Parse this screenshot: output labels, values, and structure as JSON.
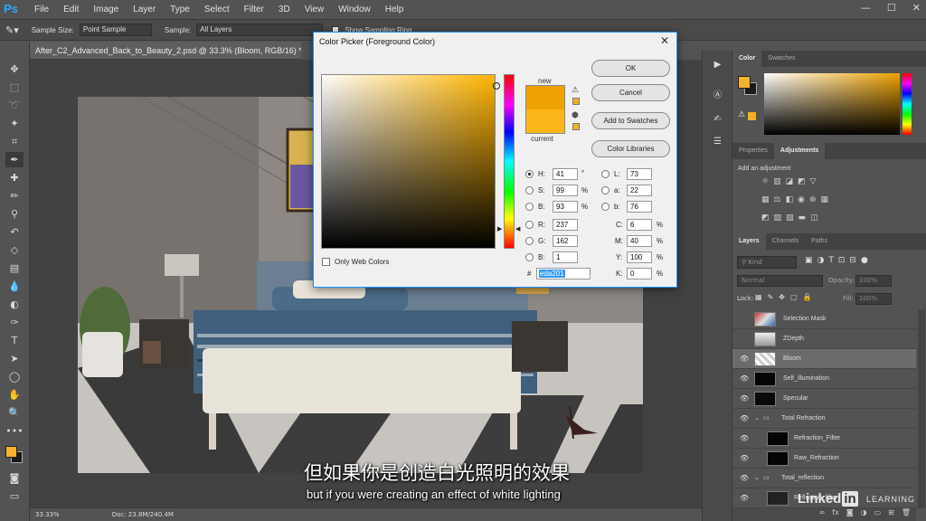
{
  "app": {
    "logo": "Ps"
  },
  "menu": [
    "File",
    "Edit",
    "Image",
    "Layer",
    "Type",
    "Select",
    "Filter",
    "3D",
    "View",
    "Window",
    "Help"
  ],
  "window_controls": [
    "—",
    "☐",
    "✕"
  ],
  "options_bar": {
    "sample_size_label": "Sample Size:",
    "sample_size_value": "Point Sample",
    "sample_label": "Sample:",
    "sample_value": "All Layers",
    "show_ring_label": "Show Sampling Ring"
  },
  "document": {
    "tab_title": "After_C2_Advanced_Back_to_Beauty_2.psd @ 33.3% (Bloom, RGB/16) *",
    "zoom": "33.33%",
    "doc_size": "Doc: 23.8M/240.4M"
  },
  "color_picker": {
    "title": "Color Picker (Foreground Color)",
    "new_label": "new",
    "current_label": "current",
    "buttons": {
      "ok": "OK",
      "cancel": "Cancel",
      "add_swatches": "Add to Swatches",
      "libraries": "Color Libraries"
    },
    "fields": {
      "H": "41",
      "S": "99",
      "Bv": "93",
      "R": "237",
      "G": "162",
      "Bc": "1",
      "L": "73",
      "a": "22",
      "b": "76",
      "C": "6",
      "M": "40",
      "Y": "100",
      "K": "0"
    },
    "units": {
      "deg": "°",
      "pct": "%"
    },
    "hex_label": "#",
    "hex": "eda201",
    "web_only_label": "Only Web Colors",
    "new_color": "#eda201",
    "current_color": "#fcb61a"
  },
  "panels": {
    "color_tabs": [
      "Color",
      "Swatches"
    ],
    "adj_tabs": [
      "Properties",
      "Adjustments"
    ],
    "add_adjustment": "Add an adjustment",
    "layers_tabs": [
      "Layers",
      "Channels",
      "Paths"
    ],
    "kind_label": "Kind",
    "blend_mode": "Normal",
    "opacity_label": "Opacity:",
    "opacity_value": "100%",
    "lock_label": "Lock:",
    "fill_label": "Fill:",
    "fill_value": "100%",
    "layers": [
      {
        "name": "Selection Mask",
        "visible": false
      },
      {
        "name": "ZDepth",
        "visible": false
      },
      {
        "name": "Bloom",
        "visible": true,
        "selected": true
      },
      {
        "name": "Self_illumination",
        "visible": true
      },
      {
        "name": "Specular",
        "visible": true
      },
      {
        "name": "Total Refraction",
        "visible": true,
        "group": true
      },
      {
        "name": "Refraction_Filter",
        "visible": true
      },
      {
        "name": "Raw_Refraction",
        "visible": true
      },
      {
        "name": "Total_reflection",
        "visible": true,
        "group": true
      },
      {
        "name": "Reflection_filter",
        "visible": true
      }
    ]
  },
  "subtitles": {
    "cn": "但如果你是创造白光照明的效果",
    "en": "but if you were creating an effect of white lighting"
  },
  "watermark": {
    "brand": "Linked",
    "brand_in": "in",
    "suffix": "LEARNING"
  }
}
